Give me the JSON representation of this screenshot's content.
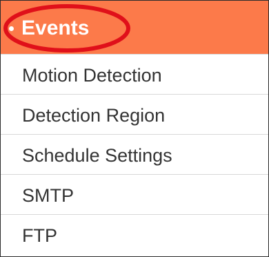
{
  "menu": {
    "header": {
      "label": "Events",
      "bullet": "•",
      "background_color": "#fc7a4a",
      "text_color": "#ffffff"
    },
    "highlight": {
      "shape": "ellipse",
      "color": "#e0101a"
    },
    "items": [
      {
        "label": "Motion Detection"
      },
      {
        "label": "Detection Region"
      },
      {
        "label": "Schedule Settings"
      },
      {
        "label": "SMTP"
      },
      {
        "label": "FTP"
      }
    ]
  }
}
